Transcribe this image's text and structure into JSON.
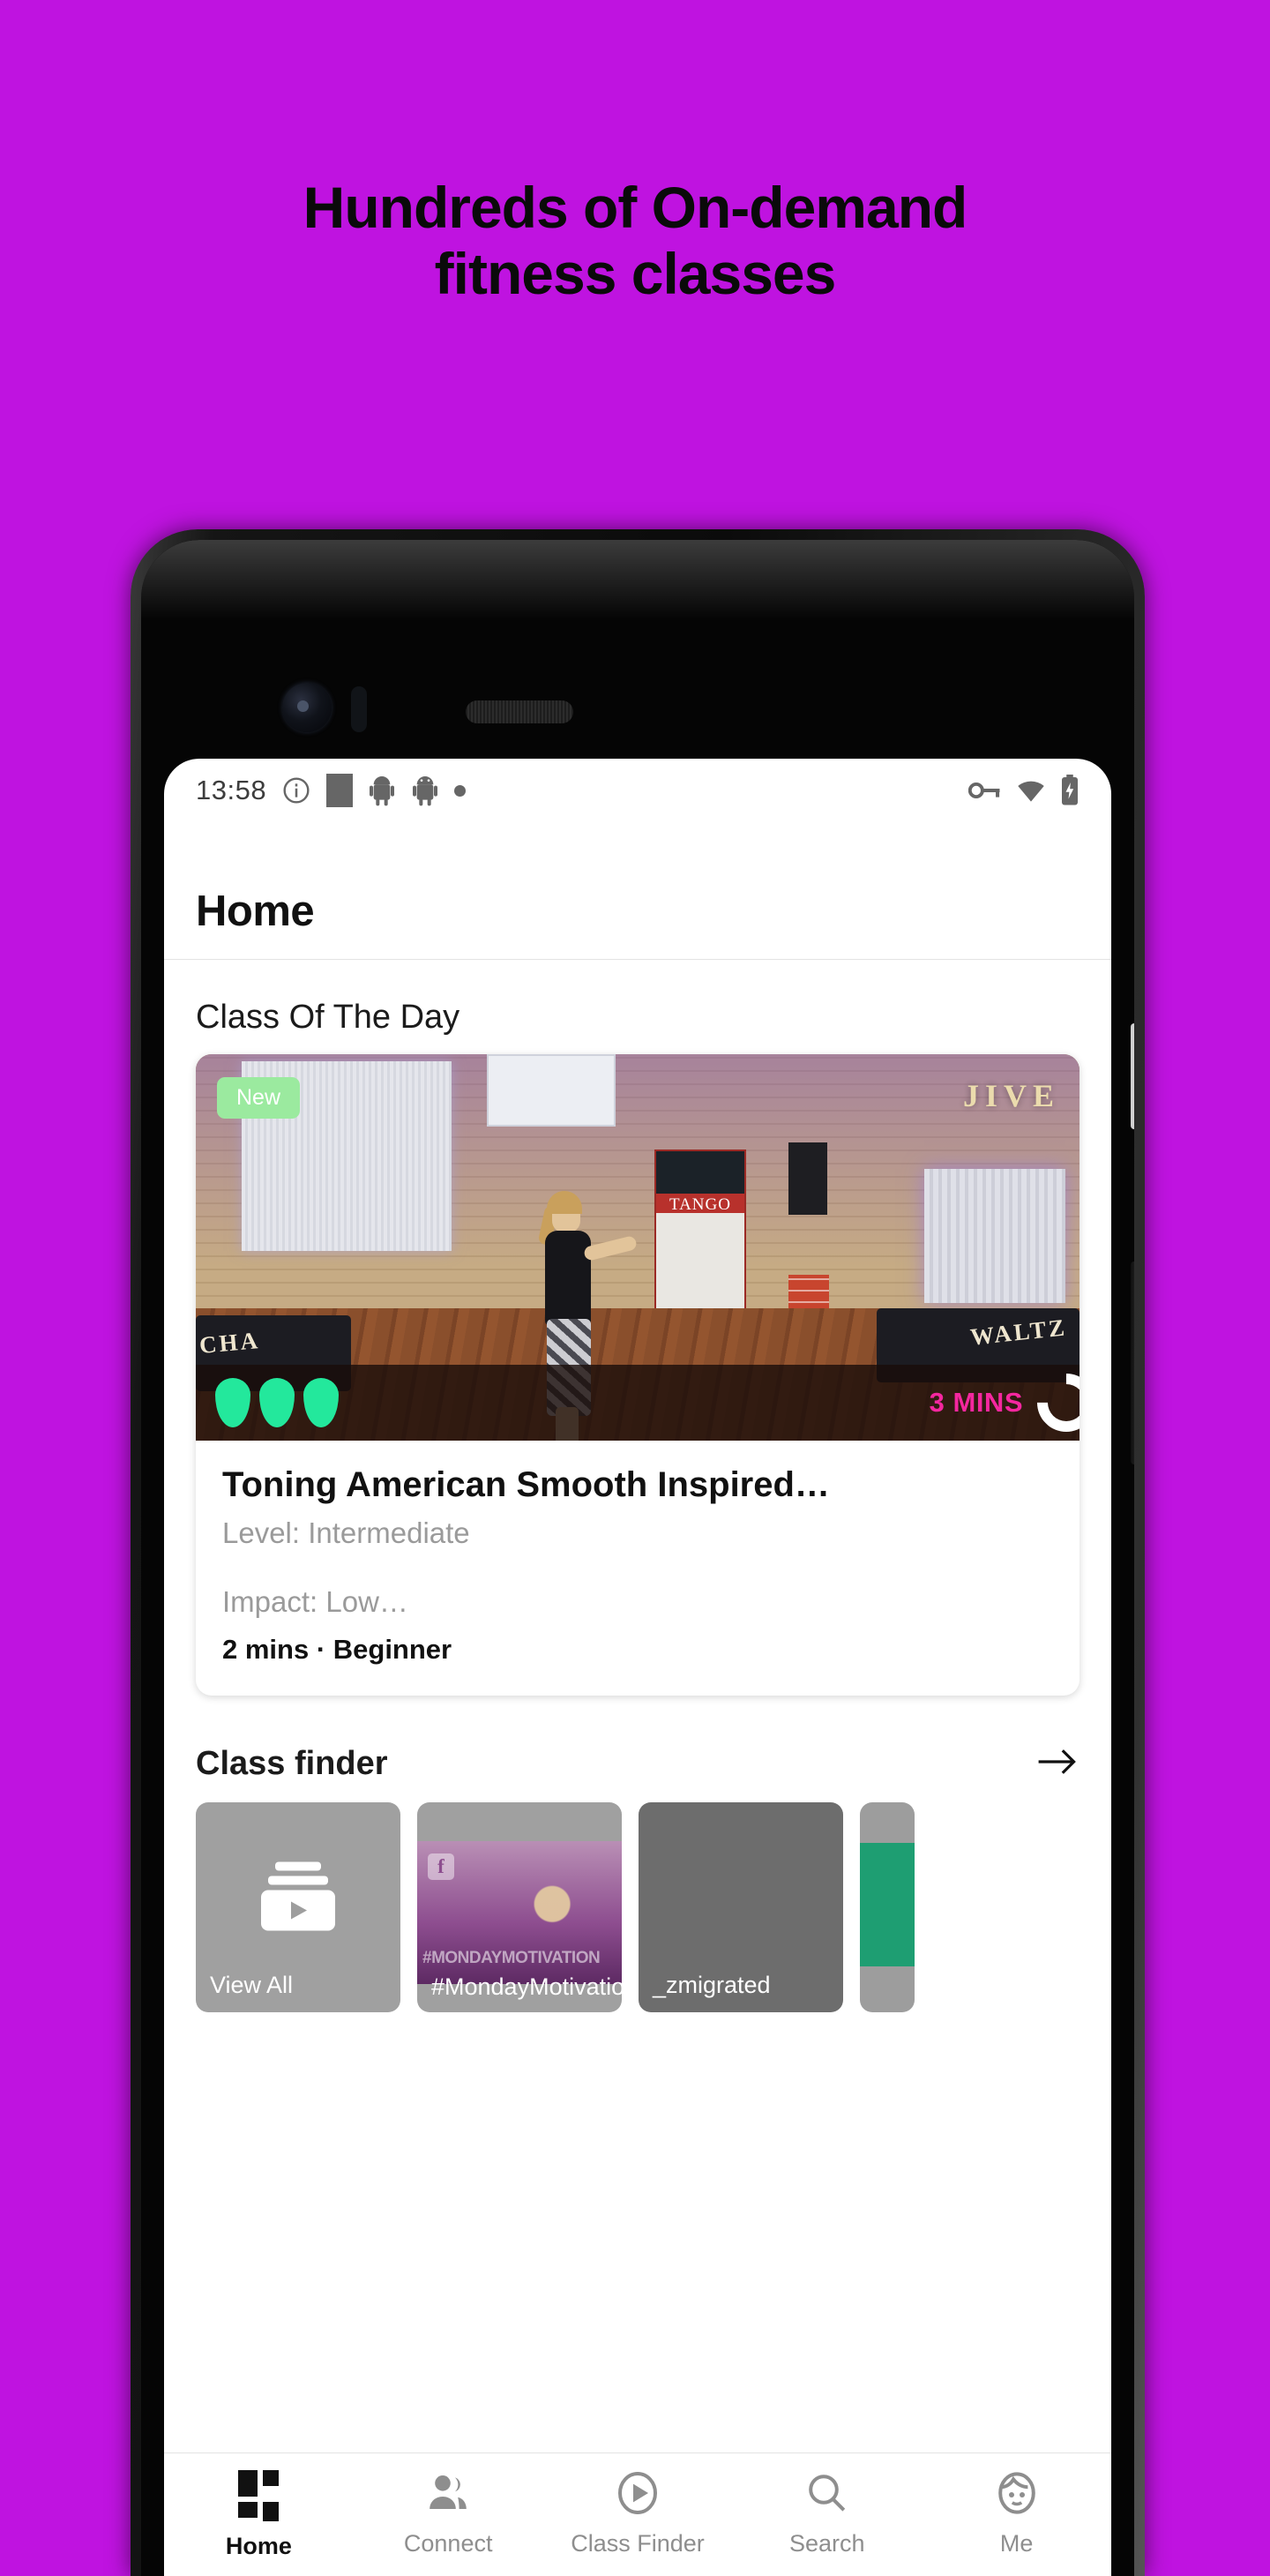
{
  "marketing": {
    "headline_line1": "Hundreds of On-demand",
    "headline_line2": "fitness classes",
    "background_color": "#bf13e0"
  },
  "status_bar": {
    "time": "13:58",
    "icons_left": [
      "info-icon",
      "square-icon",
      "android-icon",
      "android-icon",
      "dot-icon"
    ],
    "icons_right": [
      "vpn-key-icon",
      "wifi-icon",
      "battery-icon"
    ]
  },
  "app_bar": {
    "title": "Home"
  },
  "class_of_the_day": {
    "section_title": "Class Of The Day",
    "badge": "New",
    "intensity_drops": 3,
    "intensity_color": "#23e89c",
    "duration_overlay": "3 MINS",
    "duration_color": "#f5279f",
    "title": "Toning American Smooth Inspired…",
    "level": "Level: Intermediate",
    "impact": "Impact: Low…",
    "meta": "2 mins · Beginner"
  },
  "class_finder": {
    "section_title": "Class finder",
    "arrow": "→",
    "tiles": [
      {
        "label": "View All",
        "type": "view-all"
      },
      {
        "label": "#MondayMotivation",
        "type": "collection"
      },
      {
        "label": "_zmigrated",
        "type": "collection"
      },
      {
        "label": "",
        "type": "partial"
      }
    ]
  },
  "bottom_nav": {
    "items": [
      {
        "label": "Home",
        "icon": "dashboard-icon",
        "active": true
      },
      {
        "label": "Connect",
        "icon": "people-icon",
        "active": false
      },
      {
        "label": "Class Finder",
        "icon": "play-circle-icon",
        "active": false
      },
      {
        "label": "Search",
        "icon": "search-icon",
        "active": false
      },
      {
        "label": "Me",
        "icon": "face-icon",
        "active": false
      }
    ]
  }
}
